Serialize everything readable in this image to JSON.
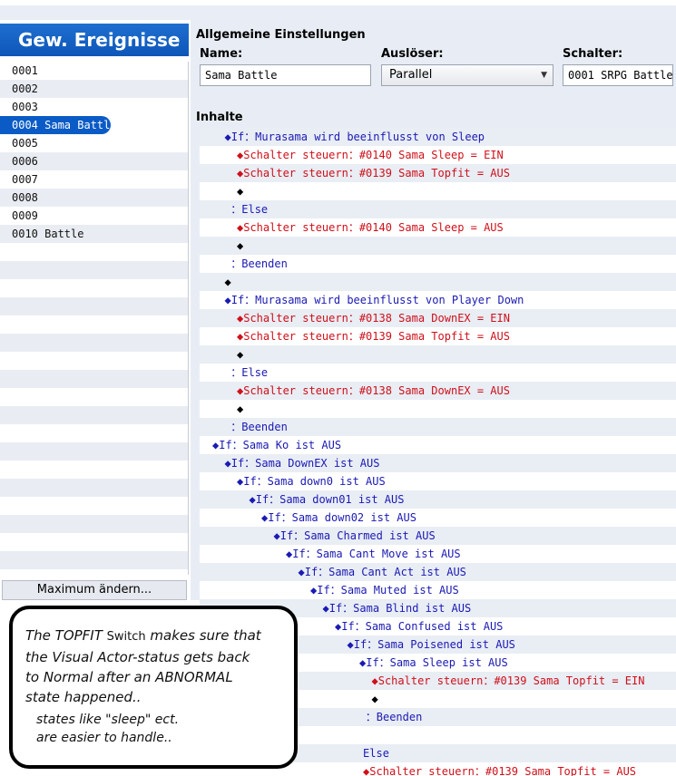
{
  "left_panel": {
    "title": "Gew. Ereignisse",
    "items": [
      {
        "label": "0001"
      },
      {
        "label": "0002"
      },
      {
        "label": "0003"
      },
      {
        "label": "0004 Sama Battle",
        "selected": true
      },
      {
        "label": "0005"
      },
      {
        "label": "0006"
      },
      {
        "label": "0007"
      },
      {
        "label": "0008"
      },
      {
        "label": "0009"
      },
      {
        "label": "0010 Battle"
      }
    ],
    "max_button": "Maximum ändern..."
  },
  "settings": {
    "title": "Allgemeine Einstellungen",
    "name_label": "Name:",
    "name_value": "Sama Battle",
    "trigger_label": "Auslöser:",
    "trigger_value": "Parallel",
    "switch_label": "Schalter:",
    "switch_value": "0001 SRPG Battle"
  },
  "content": {
    "title": "Inhalte",
    "lines": [
      {
        "indent": 1,
        "text": "◆If：Murasama wird beeinflusst von Sleep",
        "color": "blue"
      },
      {
        "indent": 2,
        "text": "◆Schalter steuern：#0140 Sama Sleep = EIN",
        "color": "red"
      },
      {
        "indent": 2,
        "text": "◆Schalter steuern：#0139 Sama Topfit = AUS",
        "color": "red"
      },
      {
        "indent": 2,
        "text": "◆",
        "color": "black"
      },
      {
        "indent": 1.5,
        "text": "：Else",
        "color": "blue"
      },
      {
        "indent": 2,
        "text": "◆Schalter steuern：#0140 Sama Sleep = AUS",
        "color": "red"
      },
      {
        "indent": 2,
        "text": "◆",
        "color": "black"
      },
      {
        "indent": 1.5,
        "text": "：Beenden",
        "color": "blue"
      },
      {
        "indent": 1,
        "text": "◆",
        "color": "black"
      },
      {
        "indent": 1,
        "text": "◆If：Murasama wird beeinflusst von Player Down",
        "color": "blue"
      },
      {
        "indent": 2,
        "text": "◆Schalter steuern：#0138 Sama DownEX = EIN",
        "color": "red"
      },
      {
        "indent": 2,
        "text": "◆Schalter steuern：#0139 Sama Topfit = AUS",
        "color": "red"
      },
      {
        "indent": 2,
        "text": "◆",
        "color": "black"
      },
      {
        "indent": 1.5,
        "text": "：Else",
        "color": "blue"
      },
      {
        "indent": 2,
        "text": "◆Schalter steuern：#0138 Sama DownEX = AUS",
        "color": "red"
      },
      {
        "indent": 2,
        "text": "◆",
        "color": "black"
      },
      {
        "indent": 1.5,
        "text": "：Beenden",
        "color": "blue"
      },
      {
        "indent": 0,
        "text": "◆If：Sama Ko ist AUS",
        "color": "blue"
      },
      {
        "indent": 1,
        "text": "◆If：Sama DownEX ist AUS",
        "color": "blue"
      },
      {
        "indent": 2,
        "text": "◆If：Sama down0 ist AUS",
        "color": "blue"
      },
      {
        "indent": 3,
        "text": "◆If：Sama down01 ist AUS",
        "color": "blue"
      },
      {
        "indent": 4,
        "text": "◆If：Sama down02 ist AUS",
        "color": "blue"
      },
      {
        "indent": 5,
        "text": "◆If：Sama Charmed ist AUS",
        "color": "blue"
      },
      {
        "indent": 6,
        "text": "◆If：Sama Cant Move ist AUS",
        "color": "blue"
      },
      {
        "indent": 7,
        "text": "◆If：Sama Cant Act ist AUS",
        "color": "blue"
      },
      {
        "indent": 8,
        "text": "◆If：Sama Muted ist AUS",
        "color": "blue"
      },
      {
        "indent": 9,
        "text": "◆If：Sama Blind ist AUS",
        "color": "blue"
      },
      {
        "indent": 10,
        "text": "◆If：Sama Confused ist AUS",
        "color": "blue"
      },
      {
        "indent": 11,
        "text": "◆If：Sama Poisened ist AUS",
        "color": "blue"
      },
      {
        "indent": 12,
        "text": "◆If：Sama Sleep ist AUS",
        "color": "blue"
      },
      {
        "indent": 13,
        "text": "◆Schalter steuern：#0139 Sama Topfit = EIN",
        "color": "red"
      },
      {
        "indent": 13,
        "text": "◆",
        "color": "black"
      },
      {
        "indent": 12.5,
        "text": "：Beenden",
        "color": "blue"
      },
      {
        "indent": 12.3,
        "text": "",
        "color": "black"
      },
      {
        "indent": 12.3,
        "text": "Else",
        "color": "blue"
      },
      {
        "indent": 12.3,
        "text": "◆Schalter steuern：#0139 Sama Topfit = AUS",
        "color": "red"
      }
    ]
  },
  "annotation": {
    "line1a": "The TOPFIT ",
    "line1b": "Switch",
    "line1c": " makes sure that",
    "line2": "the Visual Actor-status gets back",
    "line3": "to Normal after an ABNORMAL",
    "line4": "state  happened..",
    "line5": "states like  \"sleep\" ect.",
    "line6": "are easier to handle.."
  },
  "colors": {
    "accent": "#0a5bc6",
    "if_text": "#1a1ab4",
    "action_text": "#d0101a"
  }
}
